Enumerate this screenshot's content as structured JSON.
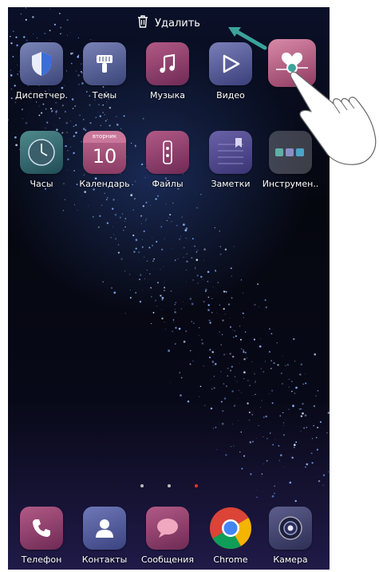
{
  "topbar": {
    "delete_label": "Удалить"
  },
  "row1": [
    {
      "label": "Диспетчер.",
      "icon": "shield-icon"
    },
    {
      "label": "Темы",
      "icon": "brush-icon"
    },
    {
      "label": "Музыка",
      "icon": "music-icon"
    },
    {
      "label": "Видео",
      "icon": "play-icon"
    },
    {
      "label": "",
      "icon": "health-icon"
    }
  ],
  "row2": [
    {
      "label": "Часы",
      "icon": "clock-icon"
    },
    {
      "label": "Календарь",
      "icon": "calendar-icon",
      "weekday": "вторник",
      "day": "10"
    },
    {
      "label": "Файлы",
      "icon": "files-icon"
    },
    {
      "label": "Заметки",
      "icon": "notes-icon"
    },
    {
      "label": "Инструмен..",
      "icon": "tools-folder-icon"
    }
  ],
  "dock": [
    {
      "label": "Телефон",
      "icon": "phone-icon"
    },
    {
      "label": "Контакты",
      "icon": "contacts-icon"
    },
    {
      "label": "Сообщения",
      "icon": "messages-icon"
    },
    {
      "label": "Chrome",
      "icon": "chrome-icon"
    },
    {
      "label": "Камера",
      "icon": "camera-icon"
    }
  ],
  "page_indicator": {
    "pages": 3,
    "current": 3
  },
  "colors": {
    "accent": "#e53030",
    "arrow": "#3aa39a",
    "tile": "#9b467a"
  }
}
